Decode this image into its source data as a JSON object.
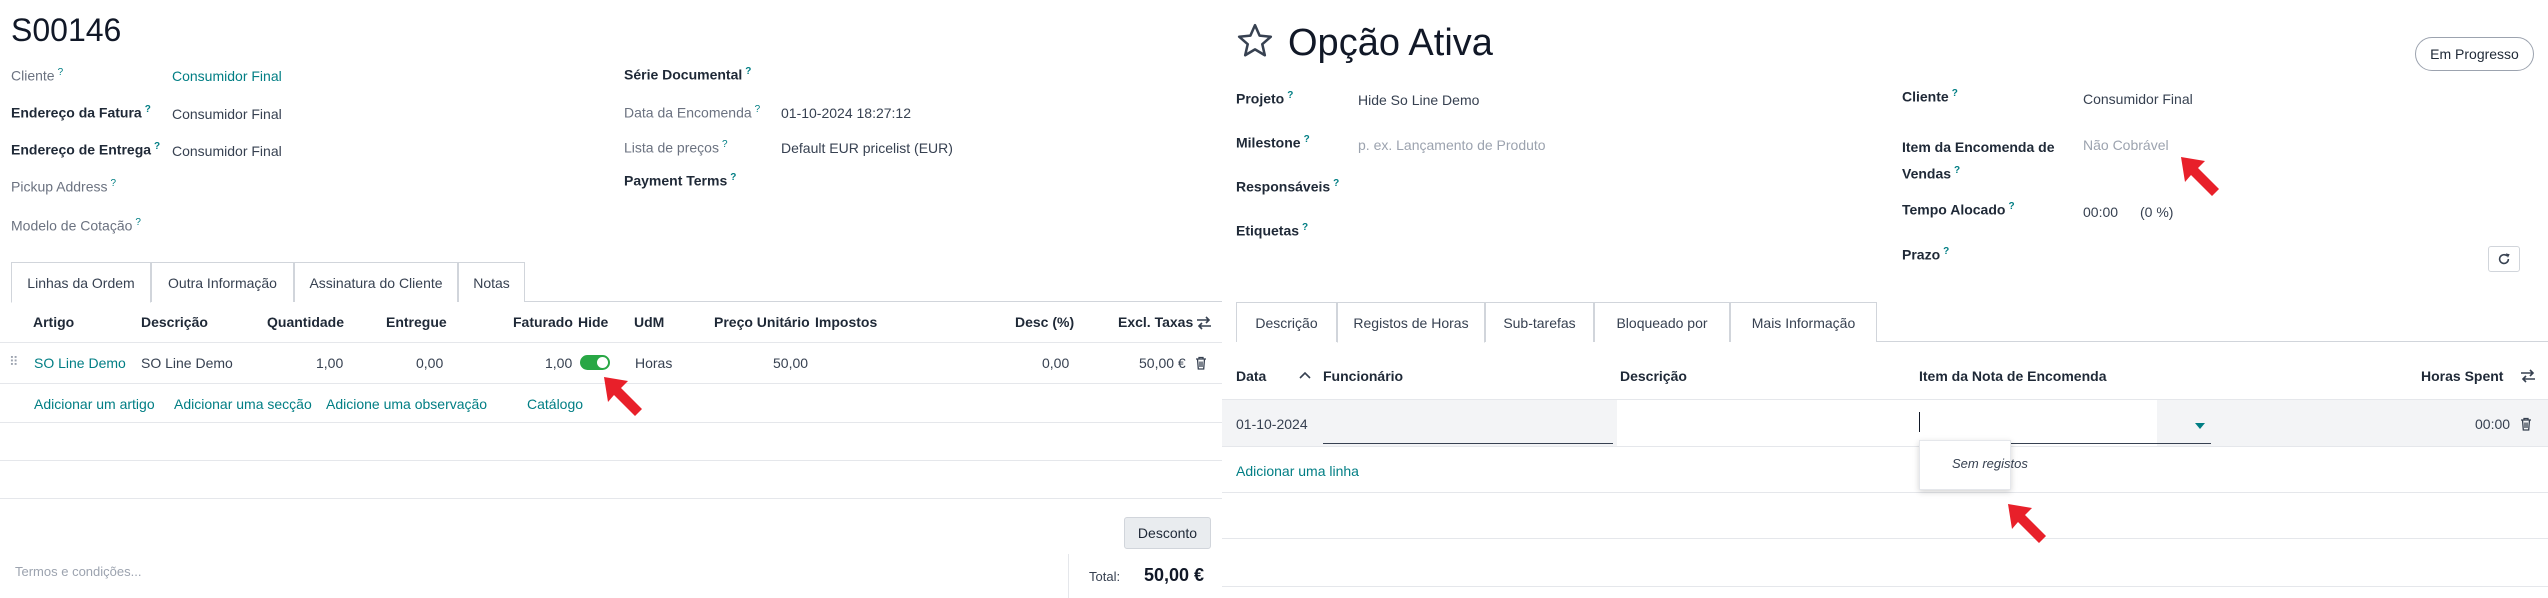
{
  "order": {
    "title": "S00146",
    "fields_left": [
      {
        "label": "Cliente",
        "value": "Consumidor Final"
      },
      {
        "label": "Endereço da Fatura",
        "value": "Consumidor Final"
      },
      {
        "label": "Endereço de Entrega",
        "value": "Consumidor Final"
      },
      {
        "label": "Pickup Address",
        "value": ""
      },
      {
        "label": "Modelo de Cotação",
        "value": ""
      }
    ],
    "fields_right": [
      {
        "label": "Série Documental",
        "value": ""
      },
      {
        "label": "Data da Encomenda",
        "value": "01-10-2024 18:27:12"
      },
      {
        "label": "Lista de preços",
        "value": "Default EUR pricelist (EUR)"
      },
      {
        "label": "Payment Terms",
        "value": ""
      }
    ],
    "tabs": [
      "Linhas da Ordem",
      "Outra Informação",
      "Assinatura do Cliente",
      "Notas"
    ],
    "columns": [
      "Artigo",
      "Descrição",
      "Quantidade",
      "Entregue",
      "Faturado",
      "Hide",
      "UdM",
      "Preço Unitário",
      "Impostos",
      "Desc (%)",
      "Excl. Taxas"
    ],
    "row": {
      "artigo": "SO Line Demo",
      "descricao": "SO Line Demo",
      "quantidade": "1,00",
      "entregue": "0,00",
      "faturado": "1,00",
      "hide": true,
      "udm": "Horas",
      "preco": "50,00",
      "impostos": "",
      "desc": "0,00",
      "excl": "50,00 €"
    },
    "add_links": [
      "Adicionar um artigo",
      "Adicionar uma secção",
      "Adicione uma observação",
      "Catálogo"
    ],
    "discount_button": "Desconto",
    "terms_placeholder": "Termos e condições...",
    "total_label": "Total:",
    "total_value": "50,00 €"
  },
  "task": {
    "title": "Opção Ativa",
    "status": "Em Progresso",
    "fields_left": [
      {
        "label": "Projeto",
        "value": "Hide So Line Demo"
      },
      {
        "label": "Milestone",
        "value": "p. ex. Lançamento de Produto"
      },
      {
        "label": "Responsáveis",
        "value": ""
      },
      {
        "label": "Etiquetas",
        "value": ""
      }
    ],
    "fields_right": {
      "cliente_label": "Cliente",
      "cliente_value": "Consumidor Final",
      "item_label_1": "Item da Encomenda de",
      "item_label_2": "Vendas",
      "item_value": "Não Cobrável",
      "tempo_label": "Tempo Alocado",
      "tempo_value": "00:00",
      "tempo_pct": "(0 %)",
      "prazo_label": "Prazo"
    },
    "tabs": [
      "Descrição",
      "Registos de Horas",
      "Sub-tarefas",
      "Bloqueado por",
      "Mais Informação"
    ],
    "columns": [
      "Data",
      "Funcionário",
      "Descrição",
      "Item da Nota de Encomenda",
      "Horas Spent"
    ],
    "row": {
      "data": "01-10-2024",
      "funcionario": "",
      "descricao": "",
      "item": "",
      "horas": "00:00"
    },
    "dropdown_text": "Sem registos",
    "add_line": "Adicionar uma linha"
  },
  "colors": {
    "accent": "#017e84",
    "toggle": "#28a745",
    "arrow": "#e8202a"
  }
}
